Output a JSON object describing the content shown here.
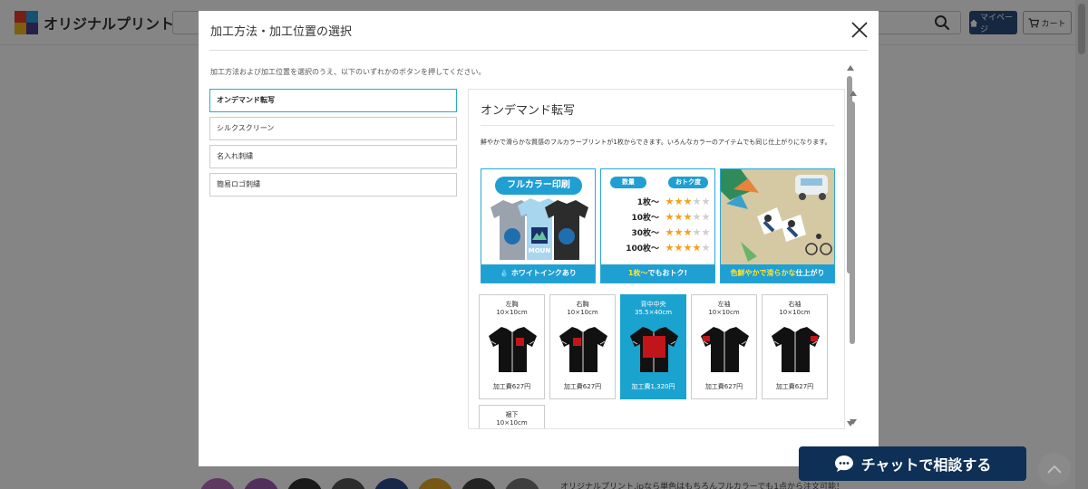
{
  "header": {
    "logo_text": "オリジナルプリント.jp",
    "mypage_label": "マイページ",
    "cart_label": "カート"
  },
  "background": {
    "note": "オリジナルプリント.jpなら単色はもちろんフルカラーでも1点から注文可能！"
  },
  "modal": {
    "title": "加工方法・加工位置の選択",
    "instruction": "加工方法および加工位置を選択のうえ、以下のいずれかのボタンを押してください。",
    "methods": [
      {
        "label": "オンデマンド転写",
        "active": true
      },
      {
        "label": "シルクスクリーン",
        "active": false
      },
      {
        "label": "名入れ刺繍",
        "active": false
      },
      {
        "label": "簡易ロゴ刺繍",
        "active": false
      }
    ],
    "detail": {
      "title": "オンデマンド転写",
      "description": "鮮やかで滑らかな質感のフルカラープリントが1枚からできます。いろんなカラーのアイテムでも同じ仕上がりになります。",
      "card1": {
        "pill": "フルカラー印刷",
        "shirt_text": "MOUN",
        "banner": "ホワイトインクあり"
      },
      "card2": {
        "head_qty": "数量",
        "head_value": "おトク度",
        "rows": [
          {
            "qty": "1枚～",
            "stars": 3
          },
          {
            "qty": "10枚～",
            "stars": 3
          },
          {
            "qty": "30枚～",
            "stars": 3
          },
          {
            "qty": "100枚～",
            "stars": 4
          }
        ],
        "max_stars": 5,
        "banner_hl": "1枚～",
        "banner_rest": "でもおトク!"
      },
      "card3": {
        "banner_pre": "色鮮やかで",
        "banner_hl": "滑らかな",
        "banner_post": "仕上がり"
      },
      "positions": [
        {
          "name": "左胸",
          "size": "10×10cm",
          "price": "加工費627円",
          "selected": false,
          "mark": "left-chest"
        },
        {
          "name": "右胸",
          "size": "10×10cm",
          "price": "加工費627円",
          "selected": false,
          "mark": "right-chest"
        },
        {
          "name": "背中中央",
          "size": "35.5×40cm",
          "price": "加工費1,320円",
          "selected": true,
          "mark": "back-center"
        },
        {
          "name": "左袖",
          "size": "10×10cm",
          "price": "加工費627円",
          "selected": false,
          "mark": "left-sleeve"
        },
        {
          "name": "右袖",
          "size": "10×10cm",
          "price": "加工費627円",
          "selected": false,
          "mark": "right-sleeve"
        },
        {
          "name": "裾下",
          "size": "10×10cm",
          "price": "",
          "selected": false,
          "mark": "hem"
        }
      ]
    }
  },
  "chat": {
    "label": "チャットで相談する"
  },
  "colors": {
    "accent": "#1aa3cf",
    "navy": "#0e2f56",
    "star_on": "#f5a01a",
    "print_mark": "#c0161b"
  }
}
